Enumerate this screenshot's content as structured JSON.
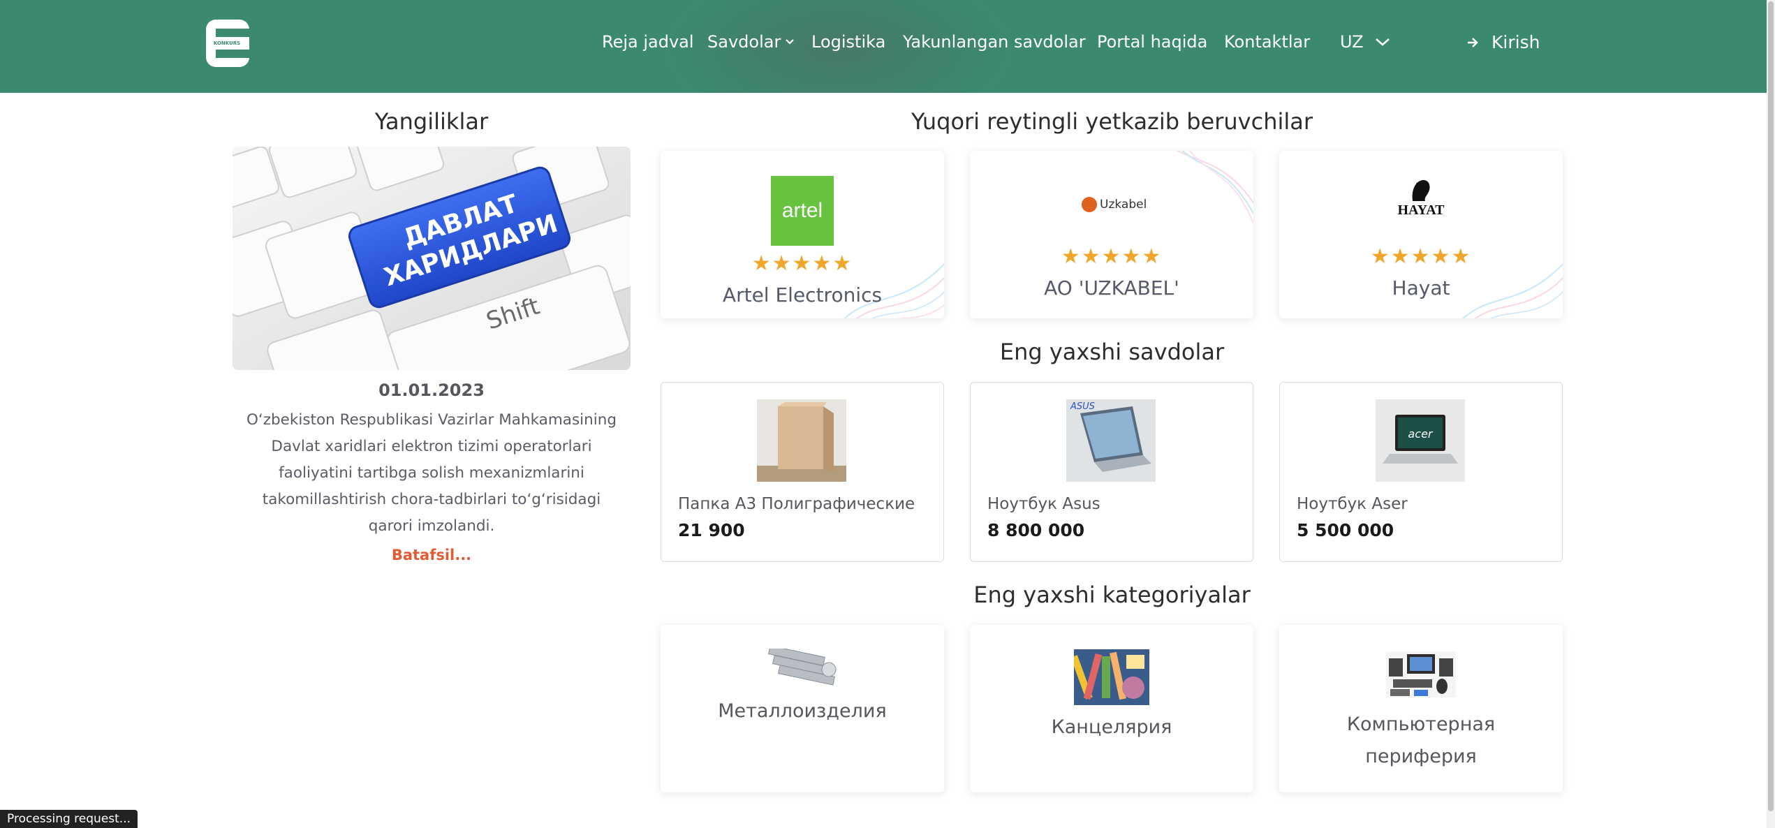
{
  "header": {
    "logo_text": "KONKURS",
    "nav": [
      "Reja jadval",
      "Savdolar",
      "Logistika",
      "Yakunlangan savdolar",
      "Portal haqida",
      "Kontaktlar"
    ],
    "language": "UZ",
    "login": "Kirish"
  },
  "news": {
    "title": "Yangiliklar",
    "image_text_line1": "ДАВЛАТ",
    "image_text_line2": "ХАРИДЛАРИ",
    "image_key_label": "Shift",
    "date": "01.01.2023",
    "text": "O‘zbekiston Respublikasi Vazirlar Mahkamasining Davlat xaridlari elektron tizimi operatorlari faoliyatini tartibga solish mexanizmlarini takomillashtirish chora-tadbirlari to‘g‘risidagi qarori imzolandi.",
    "more": "Batafsil..."
  },
  "suppliers": {
    "title": "Yuqori reytingli yetkazib beruvchilar",
    "items": [
      {
        "name": "Artel Electronics",
        "logo_text": "artel",
        "stars": "★★★★★",
        "rating": 5
      },
      {
        "name": "AO 'UZKABEL'",
        "logo_text": "Uzkabel",
        "stars": "★★★★★",
        "rating": 5
      },
      {
        "name": "Hayat",
        "logo_text": "HAYAT",
        "stars": "★★★★★",
        "rating": 5
      }
    ]
  },
  "deals": {
    "title": "Eng yaxshi savdolar",
    "items": [
      {
        "name": "Папка А3 Полиграфические",
        "price": "21 900"
      },
      {
        "name": "Ноутбук Asus",
        "price": "8 800 000",
        "image_logo": "ASUS"
      },
      {
        "name": "Ноутбук Aser",
        "price": "5 500 000",
        "image_logo": "acer"
      }
    ]
  },
  "categories": {
    "title": "Eng yaxshi kategoriyalar",
    "items": [
      {
        "name": "Металлоизделия"
      },
      {
        "name": "Канцелярия"
      },
      {
        "name": "Компьютерная периферия"
      }
    ]
  },
  "status_bar": "Processing request...",
  "colors": {
    "header": "#3b8a6f",
    "star": "#f0a62a",
    "accent": "#e05c35"
  }
}
